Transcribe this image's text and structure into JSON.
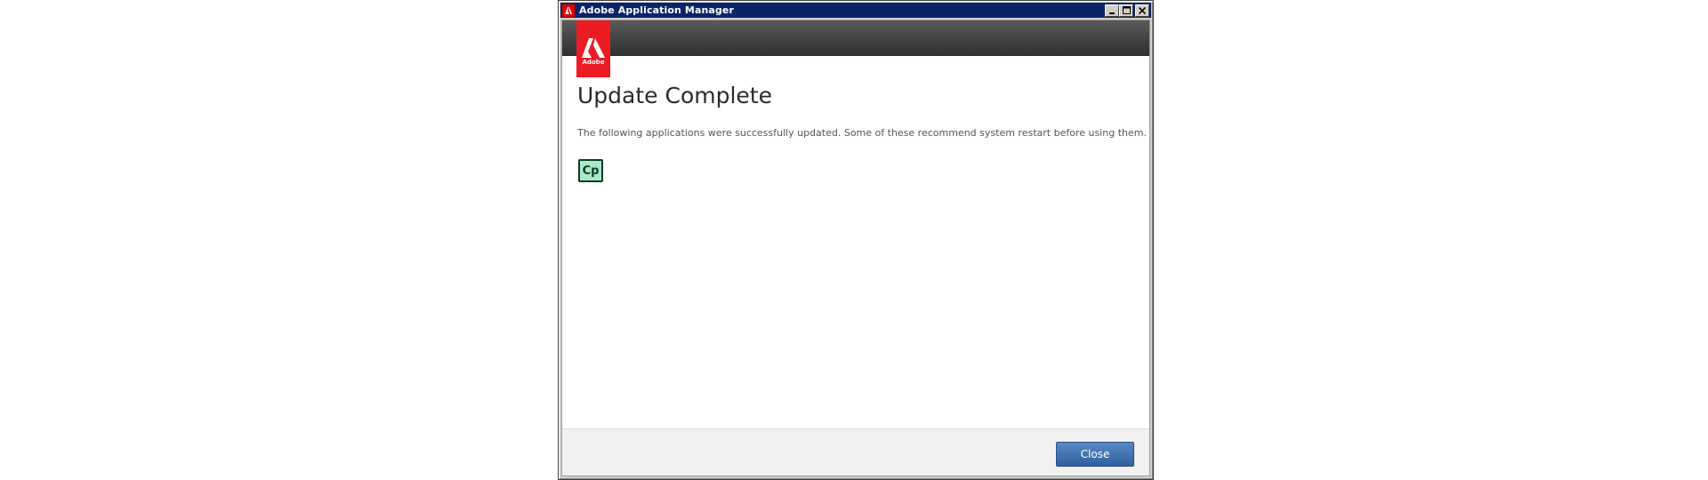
{
  "window": {
    "title": "Adobe Application Manager",
    "title_icon": "adobe-icon",
    "controls": [
      "minimize-icon",
      "maximize-icon",
      "close-icon"
    ]
  },
  "header": {
    "logo_text": "Adobe",
    "logo_color": "#ed1c24"
  },
  "main": {
    "heading": "Update Complete",
    "message": "The following applications were successfully updated. Some of these recommend system restart before using them.",
    "apps": [
      {
        "icon_label": "Cp",
        "icon_color": "#a9e8c8"
      }
    ]
  },
  "footer": {
    "close_label": "Close",
    "button_color": "#3a6aaa"
  }
}
